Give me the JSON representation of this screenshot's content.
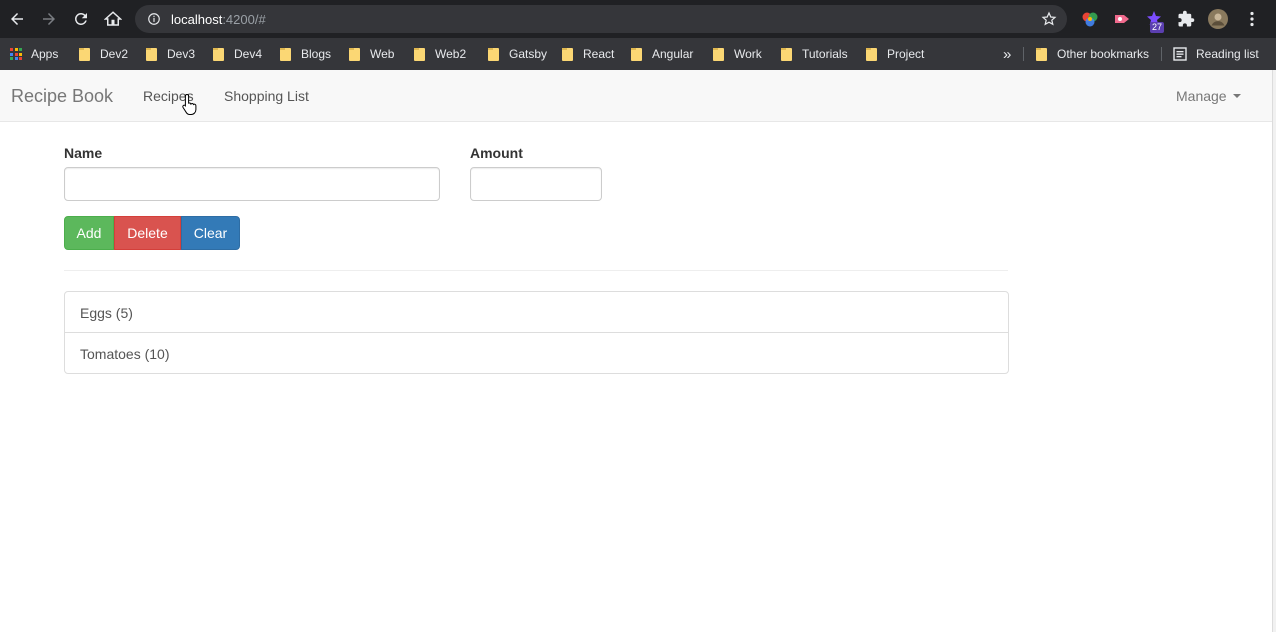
{
  "browser": {
    "url_host": "localhost",
    "url_rest": ":4200/#",
    "extension_badge": "27",
    "bookmarks": [
      {
        "label": "Apps",
        "type": "apps"
      },
      {
        "label": "Dev2",
        "type": "folder"
      },
      {
        "label": "Dev3",
        "type": "folder"
      },
      {
        "label": "Dev4",
        "type": "folder"
      },
      {
        "label": "Blogs",
        "type": "folder"
      },
      {
        "label": "Web",
        "type": "folder"
      },
      {
        "label": "Web2",
        "type": "folder"
      },
      {
        "label": "Gatsby",
        "type": "folder"
      },
      {
        "label": "React",
        "type": "folder"
      },
      {
        "label": "Angular",
        "type": "folder"
      },
      {
        "label": "Work",
        "type": "folder"
      },
      {
        "label": "Tutorials",
        "type": "folder"
      },
      {
        "label": "Project",
        "type": "folder"
      }
    ],
    "overflow_label": "»",
    "other_bookmarks": "Other bookmarks",
    "reading_list": "Reading list"
  },
  "navbar": {
    "brand": "Recipe Book",
    "links": [
      "Recipes",
      "Shopping List"
    ],
    "manage": "Manage"
  },
  "form": {
    "name_label": "Name",
    "name_value": "",
    "amount_label": "Amount",
    "amount_value": "",
    "add_label": "Add",
    "delete_label": "Delete",
    "clear_label": "Clear"
  },
  "shopping_list": [
    "Eggs (5)",
    "Tomatoes (10)"
  ],
  "colors": {
    "add": "#5cb85c",
    "delete": "#d9534f",
    "clear": "#337ab7"
  }
}
